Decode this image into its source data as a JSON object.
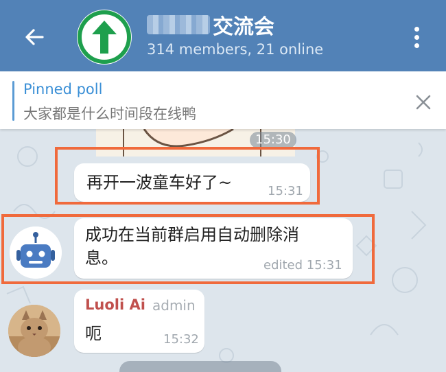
{
  "header": {
    "title_suffix": "交流会",
    "subtitle": "314 members, 21 online",
    "back_icon": "arrow-left-icon",
    "menu_icon": "more-vertical-icon",
    "avatar_icon": "green-up-arrow-icon",
    "bg_color": "#5282b7"
  },
  "pinned": {
    "label": "Pinned poll",
    "text": "大家都是什么时间段在线鸭",
    "close_icon": "close-icon"
  },
  "messages": [
    {
      "time_top": "15:30"
    },
    {
      "text": "再开一波童车好了~",
      "time": "15:31",
      "highlighted": true
    },
    {
      "text_line1": "成功在当前群启用自动删除消",
      "text_line2": "息。",
      "time": "edited 15:31",
      "avatar_icon": "robot-icon",
      "highlighted": true
    },
    {
      "sender": "Luoli Ai",
      "role": "admin",
      "text": "呃",
      "time": "15:32",
      "avatar_icon": "cat-avatar"
    }
  ],
  "colors": {
    "highlight": "#f06a3c",
    "sender_name": "#c0504d",
    "pinned_label": "#3a8fd6"
  }
}
